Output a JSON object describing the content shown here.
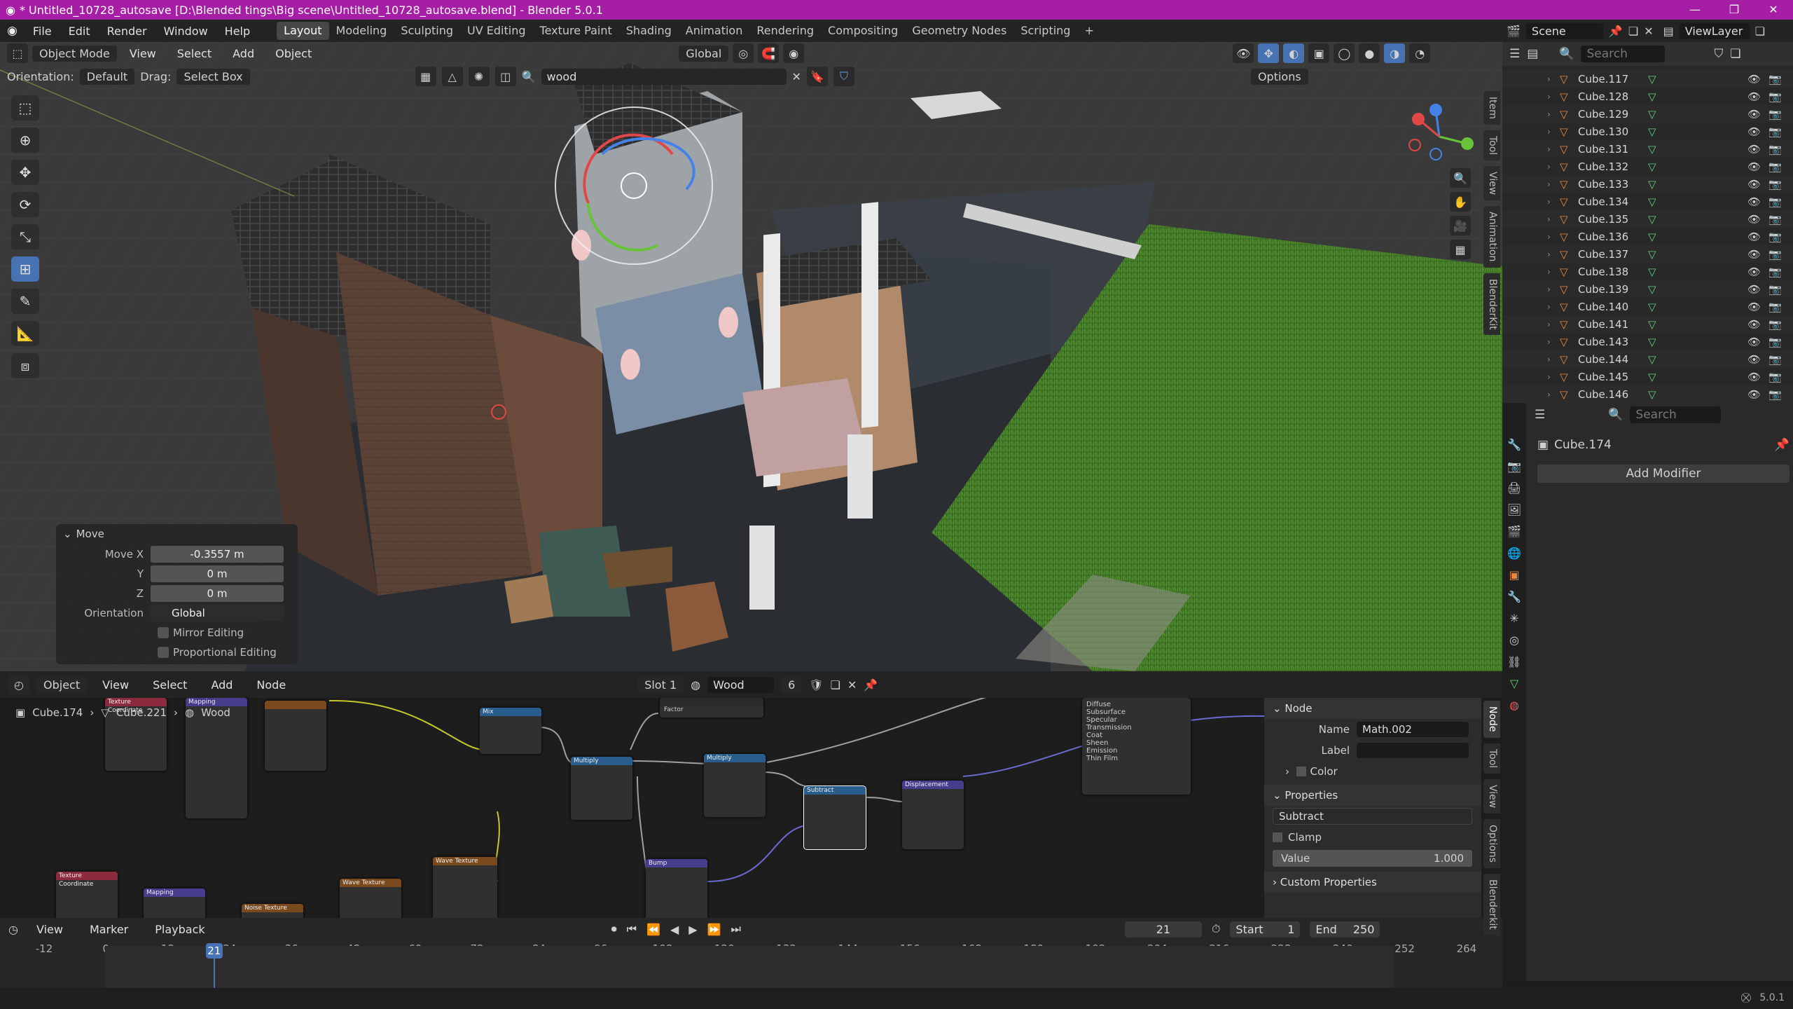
{
  "window": {
    "title": "* Untitled_10728_autosave [D:\\Blended tings\\Big scene\\Untitled_10728_autosave.blend] - Blender 5.0.1",
    "controls": [
      "—",
      "❐",
      "✕"
    ]
  },
  "menu": {
    "items": [
      "File",
      "Edit",
      "Render",
      "Window",
      "Help"
    ],
    "workspaces": [
      "Layout",
      "Modeling",
      "Sculpting",
      "UV Editing",
      "Texture Paint",
      "Shading",
      "Animation",
      "Rendering",
      "Compositing",
      "Geometry Nodes",
      "Scripting"
    ],
    "active_workspace": "Layout",
    "add_tab": "+"
  },
  "scene": {
    "scene_name": "Scene",
    "view_layer": "ViewLayer"
  },
  "viewport": {
    "mode": "Object Mode",
    "menus": [
      "View",
      "Select",
      "Add",
      "Object"
    ],
    "transform_orientation": "Global",
    "orientation_label": "Orientation:",
    "orientation_value": "Default",
    "drag_label": "Drag:",
    "drag_value": "Select Box",
    "filter_text": "wood",
    "options_label": "Options",
    "sidebar_tabs": [
      "Item",
      "Tool",
      "View",
      "Animation",
      "BlenderKit"
    ]
  },
  "move_panel": {
    "title": "Move",
    "move_x_label": "Move X",
    "move_x": "-0.3557 m",
    "y_label": "Y",
    "y": "0 m",
    "z_label": "Z",
    "z": "0 m",
    "orientation_label": "Orientation",
    "orientation": "Global",
    "mirror_editing": "Mirror Editing",
    "proportional_editing": "Proportional Editing"
  },
  "outliner": {
    "search_placeholder": "Search",
    "items": [
      "Cube.117",
      "Cube.128",
      "Cube.129",
      "Cube.130",
      "Cube.131",
      "Cube.132",
      "Cube.133",
      "Cube.134",
      "Cube.135",
      "Cube.136",
      "Cube.137",
      "Cube.138",
      "Cube.139",
      "Cube.140",
      "Cube.141",
      "Cube.143",
      "Cube.144",
      "Cube.145",
      "Cube.146"
    ]
  },
  "properties": {
    "search_placeholder": "Search",
    "object_name": "Cube.174",
    "add_modifier": "Add Modifier"
  },
  "node_editor": {
    "editor_type": "Object",
    "menus": [
      "View",
      "Select",
      "Add",
      "Node"
    ],
    "slot": "Slot 1",
    "material": "Wood",
    "users": "6",
    "breadcrumb": [
      "Cube.174",
      "Cube.221",
      "Wood"
    ],
    "side_tabs": [
      "Node",
      "Tool",
      "View",
      "Options",
      "Blenderkit"
    ],
    "node_panel": {
      "section_node": "Node",
      "name_label": "Name",
      "name_value": "Math.002",
      "label_label": "Label",
      "label_value": "",
      "color_label": "Color",
      "section_properties": "Properties",
      "operation": "Subtract",
      "clamp_label": "Clamp",
      "value_label": "Value",
      "value": "1.000",
      "custom_properties": "Custom Properties"
    },
    "nodes": {
      "texcoord": "Texture Coordinate",
      "mapping": "Mapping",
      "noise": "Noise Texture",
      "mix": "Mix",
      "multiply1": "Multiply",
      "multiply2": "Multiply",
      "subtract": "Subtract",
      "displacement": "Displacement",
      "wave": "Wave Texture",
      "bump": "Bump",
      "factor": "Factor",
      "bsdf_list": [
        "Diffuse",
        "Subsurface",
        "Specular",
        "Transmission",
        "Coat",
        "Sheen",
        "Emission",
        "Thin Film"
      ]
    }
  },
  "timeline": {
    "menus": [
      "View",
      "Marker",
      "Playback"
    ],
    "current_frame": "21",
    "start_label": "Start",
    "start": "1",
    "end_label": "End",
    "end": "250",
    "ruler": [
      "-12",
      "0",
      "12",
      "24",
      "36",
      "48",
      "60",
      "72",
      "84",
      "96",
      "108",
      "120",
      "132",
      "144",
      "156",
      "168",
      "180",
      "192",
      "204",
      "216",
      "228",
      "240",
      "252",
      "264"
    ]
  },
  "statusbar": {
    "version": "5.0.1"
  },
  "colors": {
    "title_bar": "#a51ea5",
    "accent_blue": "#4772b3",
    "object_orange": "#e8883a",
    "mesh_green": "#5fcf7a",
    "grass": "#3f7a2a"
  }
}
